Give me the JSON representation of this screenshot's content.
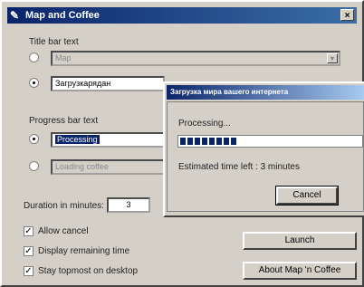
{
  "window": {
    "title": "Map and Coffee",
    "close_glyph": "×",
    "icon_glyph": "✎"
  },
  "title_bar_text": {
    "group_label": "Title bar text",
    "option1_value": "Map",
    "option2_value": "Загрузкaрядан"
  },
  "progress_bar_text": {
    "group_label": "Progress bar text",
    "option1_value": "Processing",
    "option2_value": "Loading coffee"
  },
  "duration": {
    "label": "Duration in minutes:",
    "value": "3"
  },
  "checkboxes": [
    {
      "label": "Allow cancel",
      "checked": true
    },
    {
      "label": "Display remaining time",
      "checked": true
    },
    {
      "label": "Stay topmost on desktop",
      "checked": true
    }
  ],
  "check_glyph": "✓",
  "buttons": {
    "launch": "Launch",
    "about": "About Map 'n Coffee"
  },
  "progress_dialog": {
    "title": "Загрузка мира вашего интернета",
    "status": "Processing...",
    "estimate": "Estimated time left : 3 minutes",
    "cancel_label": "Cancel",
    "progress_fraction": 0.35
  }
}
